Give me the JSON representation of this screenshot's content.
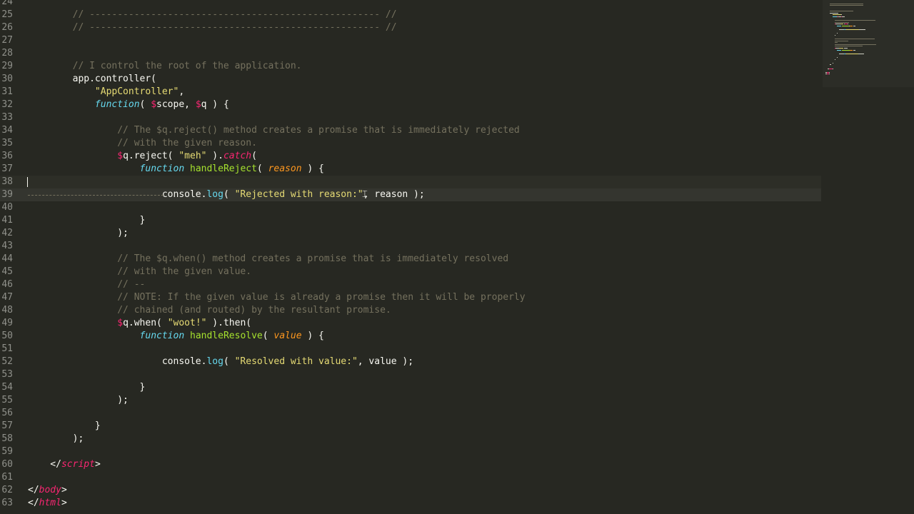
{
  "editor": {
    "theme": "dark",
    "colors": {
      "background": "#272822",
      "comment": "#75715e",
      "string": "#e6db74",
      "function_name": "#a6e22e",
      "keyword": "#66d9ef",
      "tag": "#f92672",
      "parameter": "#fd971f",
      "text": "#f8f8f2",
      "line_number": "#8f908a"
    },
    "lines": [
      {
        "n": "24",
        "tokens": []
      },
      {
        "n": "25",
        "tokens": [
          {
            "t": "        // ---------------------------------------------------- //",
            "c": "comment"
          }
        ]
      },
      {
        "n": "26",
        "tokens": [
          {
            "t": "        // ---------------------------------------------------- //",
            "c": "comment"
          }
        ]
      },
      {
        "n": "27",
        "tokens": []
      },
      {
        "n": "28",
        "tokens": []
      },
      {
        "n": "29",
        "tokens": [
          {
            "t": "        // I control the root of the application.",
            "c": "comment"
          }
        ]
      },
      {
        "n": "30",
        "tokens": [
          {
            "t": "        app.controller(",
            "c": "plain"
          }
        ]
      },
      {
        "n": "31",
        "tokens": [
          {
            "t": "            ",
            "c": "plain"
          },
          {
            "t": "\"AppController\"",
            "c": "string"
          },
          {
            "t": ",",
            "c": "plain"
          }
        ]
      },
      {
        "n": "32",
        "tokens": [
          {
            "t": "            ",
            "c": "plain"
          },
          {
            "t": "function",
            "c": "kw"
          },
          {
            "t": "( ",
            "c": "plain"
          },
          {
            "t": "$",
            "c": "dollar"
          },
          {
            "t": "scope, ",
            "c": "plain"
          },
          {
            "t": "$",
            "c": "dollar"
          },
          {
            "t": "q ) {",
            "c": "plain"
          }
        ]
      },
      {
        "n": "33",
        "tokens": []
      },
      {
        "n": "34",
        "tokens": [
          {
            "t": "                // The $q.reject() method creates a promise that is immediately rejected",
            "c": "comment"
          }
        ]
      },
      {
        "n": "35",
        "tokens": [
          {
            "t": "                // with the given reason.",
            "c": "comment"
          }
        ]
      },
      {
        "n": "36",
        "tokens": [
          {
            "t": "                ",
            "c": "plain"
          },
          {
            "t": "$",
            "c": "dollar"
          },
          {
            "t": "q.reject( ",
            "c": "plain"
          },
          {
            "t": "\"meh\"",
            "c": "string"
          },
          {
            "t": " ).",
            "c": "plain"
          },
          {
            "t": "catch",
            "c": "tag"
          },
          {
            "t": "(",
            "c": "plain"
          }
        ]
      },
      {
        "n": "37",
        "tokens": [
          {
            "t": "                    ",
            "c": "plain"
          },
          {
            "t": "function",
            "c": "kw"
          },
          {
            "t": " ",
            "c": "plain"
          },
          {
            "t": "handleReject",
            "c": "func"
          },
          {
            "t": "( ",
            "c": "plain"
          },
          {
            "t": "reason",
            "c": "param"
          },
          {
            "t": " ) {",
            "c": "plain"
          }
        ]
      },
      {
        "n": "38",
        "tokens": [],
        "state": "active"
      },
      {
        "n": "39",
        "tokens": [
          {
            "t": "                        console.",
            "c": "plain"
          },
          {
            "t": "log",
            "c": "method"
          },
          {
            "t": "( ",
            "c": "plain"
          },
          {
            "t": "\"Rejected with reason:\"",
            "c": "string"
          },
          {
            "t": ", reason );",
            "c": "plain"
          }
        ],
        "state": "selected"
      },
      {
        "n": "40",
        "tokens": []
      },
      {
        "n": "41",
        "tokens": [
          {
            "t": "                    }",
            "c": "plain"
          }
        ]
      },
      {
        "n": "42",
        "tokens": [
          {
            "t": "                );",
            "c": "plain"
          }
        ]
      },
      {
        "n": "43",
        "tokens": []
      },
      {
        "n": "44",
        "tokens": [
          {
            "t": "                // The $q.when() method creates a promise that is immediately resolved",
            "c": "comment"
          }
        ]
      },
      {
        "n": "45",
        "tokens": [
          {
            "t": "                // with the given value.",
            "c": "comment"
          }
        ]
      },
      {
        "n": "46",
        "tokens": [
          {
            "t": "                // --",
            "c": "comment"
          }
        ]
      },
      {
        "n": "47",
        "tokens": [
          {
            "t": "                // NOTE: If the given value is already a promise then it will be properly",
            "c": "comment"
          }
        ]
      },
      {
        "n": "48",
        "tokens": [
          {
            "t": "                // chained (and routed) by the resultant promise.",
            "c": "comment"
          }
        ]
      },
      {
        "n": "49",
        "tokens": [
          {
            "t": "                ",
            "c": "plain"
          },
          {
            "t": "$",
            "c": "dollar"
          },
          {
            "t": "q.when( ",
            "c": "plain"
          },
          {
            "t": "\"woot!\"",
            "c": "string"
          },
          {
            "t": " ).then(",
            "c": "plain"
          }
        ]
      },
      {
        "n": "50",
        "tokens": [
          {
            "t": "                    ",
            "c": "plain"
          },
          {
            "t": "function",
            "c": "kw"
          },
          {
            "t": " ",
            "c": "plain"
          },
          {
            "t": "handleResolve",
            "c": "func"
          },
          {
            "t": "( ",
            "c": "plain"
          },
          {
            "t": "value",
            "c": "param"
          },
          {
            "t": " ) {",
            "c": "plain"
          }
        ]
      },
      {
        "n": "51",
        "tokens": []
      },
      {
        "n": "52",
        "tokens": [
          {
            "t": "                        console.",
            "c": "plain"
          },
          {
            "t": "log",
            "c": "method"
          },
          {
            "t": "( ",
            "c": "plain"
          },
          {
            "t": "\"Resolved with value:\"",
            "c": "string"
          },
          {
            "t": ", value );",
            "c": "plain"
          }
        ]
      },
      {
        "n": "53",
        "tokens": []
      },
      {
        "n": "54",
        "tokens": [
          {
            "t": "                    }",
            "c": "plain"
          }
        ]
      },
      {
        "n": "55",
        "tokens": [
          {
            "t": "                );",
            "c": "plain"
          }
        ]
      },
      {
        "n": "56",
        "tokens": []
      },
      {
        "n": "57",
        "tokens": [
          {
            "t": "            }",
            "c": "plain"
          }
        ]
      },
      {
        "n": "58",
        "tokens": [
          {
            "t": "        );",
            "c": "plain"
          }
        ]
      },
      {
        "n": "59",
        "tokens": []
      },
      {
        "n": "60",
        "tokens": [
          {
            "t": "    </",
            "c": "plain"
          },
          {
            "t": "script",
            "c": "tag"
          },
          {
            "t": ">",
            "c": "plain"
          }
        ]
      },
      {
        "n": "61",
        "tokens": []
      },
      {
        "n": "62",
        "tokens": [
          {
            "t": "</",
            "c": "plain"
          },
          {
            "t": "body",
            "c": "tag"
          },
          {
            "t": ">",
            "c": "plain"
          }
        ]
      },
      {
        "n": "63",
        "tokens": [
          {
            "t": "</",
            "c": "plain"
          },
          {
            "t": "html",
            "c": "tag"
          },
          {
            "t": ">",
            "c": "plain"
          }
        ]
      }
    ]
  }
}
